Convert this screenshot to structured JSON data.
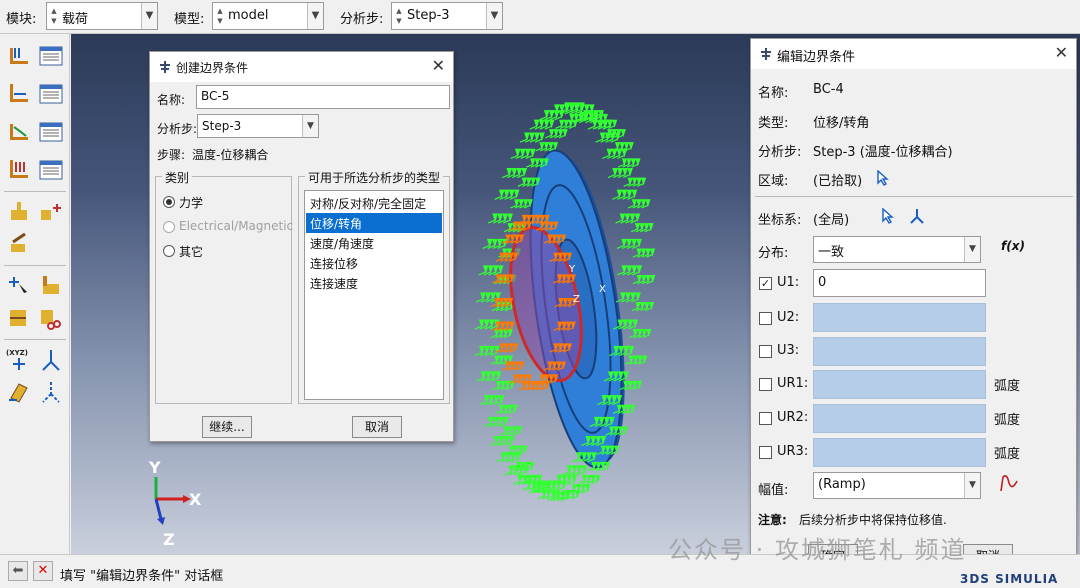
{
  "topbar": {
    "module_label": "模块:",
    "module_value": "载荷",
    "model_label": "模型:",
    "model_value": "model",
    "step_label": "分析步:",
    "step_value": "Step-3"
  },
  "toolbox": {
    "icons": [
      "bc-create-icon",
      "bc-manager-icon",
      "load-create-icon",
      "load-manager-icon",
      "predefined-field-icon",
      "field-manager-icon",
      "interaction-load-icon",
      "interaction-manager-icon",
      "fixed-point-icon",
      "constraint-icon",
      "paint-icon",
      "query-point-icon",
      "assign-csys-icon",
      "partition-icon",
      "datum-csys-icon",
      "datum-axis-icon",
      "datum-plane-icon",
      "datum-manager-icon"
    ]
  },
  "triad": {
    "y": "Y",
    "x": "X",
    "z": "Z"
  },
  "create_dialog": {
    "title": "创建边界条件",
    "name_label": "名称:",
    "name_value": "BC-5",
    "step_label": "分析步:",
    "step_value": "Step-3",
    "procedure_label": "步骤:",
    "procedure_value": "温度-位移耦合",
    "category_title": "类别",
    "categories": [
      {
        "label": "力学",
        "selected": true,
        "enabled": true
      },
      {
        "label": "Electrical/Magnetic",
        "selected": false,
        "enabled": false
      },
      {
        "label": "其它",
        "selected": false,
        "enabled": true
      }
    ],
    "types_title": "可用于所选分析步的类型",
    "types": [
      {
        "label": "对称/反对称/完全固定",
        "selected": false
      },
      {
        "label": "位移/转角",
        "selected": true
      },
      {
        "label": "速度/角速度",
        "selected": false
      },
      {
        "label": "连接位移",
        "selected": false
      },
      {
        "label": "连接速度",
        "selected": false
      }
    ],
    "continue_label": "继续...",
    "cancel_label": "取消"
  },
  "edit_dialog": {
    "title": "编辑边界条件",
    "name_label": "名称:",
    "name_value": "BC-4",
    "type_label": "类型:",
    "type_value": "位移/转角",
    "step_label": "分析步:",
    "step_value": "Step-3 (温度-位移耦合)",
    "region_label": "区域:",
    "region_value": "(已拾取)",
    "csys_label": "坐标系:",
    "csys_value": "(全局)",
    "distribution_label": "分布:",
    "distribution_value": "一致",
    "fx_label": "f(x)",
    "dofs": [
      {
        "label": "U1:",
        "checked": true,
        "value": "0",
        "unit": ""
      },
      {
        "label": "U2:",
        "checked": false,
        "value": "",
        "unit": ""
      },
      {
        "label": "U3:",
        "checked": false,
        "value": "",
        "unit": ""
      },
      {
        "label": "UR1:",
        "checked": false,
        "value": "",
        "unit": "弧度"
      },
      {
        "label": "UR2:",
        "checked": false,
        "value": "",
        "unit": "弧度"
      },
      {
        "label": "UR3:",
        "checked": false,
        "value": "",
        "unit": "弧度"
      }
    ],
    "amplitude_label": "幅值:",
    "amplitude_value": "(Ramp)",
    "note_label": "注意:",
    "note_text": "后续分析步中将保持位移值.",
    "ok_label": "确定",
    "cancel_label": "取消"
  },
  "statusbar": {
    "prompt": "填写 \"编辑边界条件\" 对话框",
    "brand": "3DS SIMULIA"
  },
  "watermark": "公众号 · 攻城狮笔札 频道",
  "colors": {
    "selection_blue": "#0a6fd0",
    "disabled_field": "#b5cde8",
    "bc_green": "#33ff33",
    "bc_orange": "#ff7a00",
    "part_blue": "#2f7fd8"
  }
}
